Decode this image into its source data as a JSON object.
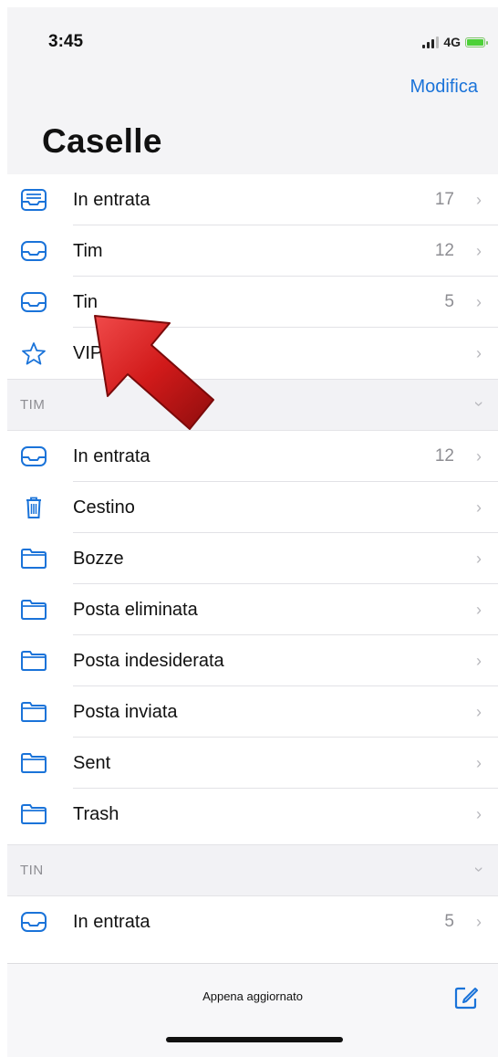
{
  "status": {
    "time": "3:45",
    "network": "4G"
  },
  "nav": {
    "edit_label": "Modifica",
    "title": "Caselle"
  },
  "mailboxes": [
    {
      "label": "In entrata",
      "count": "17",
      "icon": "tray-stack-icon"
    },
    {
      "label": "Tim",
      "count": "12",
      "icon": "tray-icon"
    },
    {
      "label": "Tin",
      "count": "5",
      "icon": "tray-icon"
    },
    {
      "label": "VIP",
      "count": "",
      "icon": "star-icon"
    }
  ],
  "sections": [
    {
      "title": "TIM",
      "items": [
        {
          "label": "In entrata",
          "count": "12",
          "icon": "tray-icon"
        },
        {
          "label": "Cestino",
          "count": "",
          "icon": "trash-icon"
        },
        {
          "label": "Bozze",
          "count": "",
          "icon": "folder-icon"
        },
        {
          "label": "Posta eliminata",
          "count": "",
          "icon": "folder-icon"
        },
        {
          "label": "Posta indesiderata",
          "count": "",
          "icon": "folder-icon"
        },
        {
          "label": "Posta inviata",
          "count": "",
          "icon": "folder-icon"
        },
        {
          "label": "Sent",
          "count": "",
          "icon": "folder-icon"
        },
        {
          "label": "Trash",
          "count": "",
          "icon": "folder-icon"
        }
      ]
    },
    {
      "title": "TIN",
      "items": [
        {
          "label": "In entrata",
          "count": "5",
          "icon": "tray-icon"
        }
      ]
    }
  ],
  "chevron": "›",
  "toolbar": {
    "status_text": "Appena aggiornato",
    "compose_icon": "compose-icon"
  },
  "colors": {
    "accent": "#1a73d9",
    "arrow": "#d11a1a",
    "section_bg": "#f2f2f5"
  }
}
